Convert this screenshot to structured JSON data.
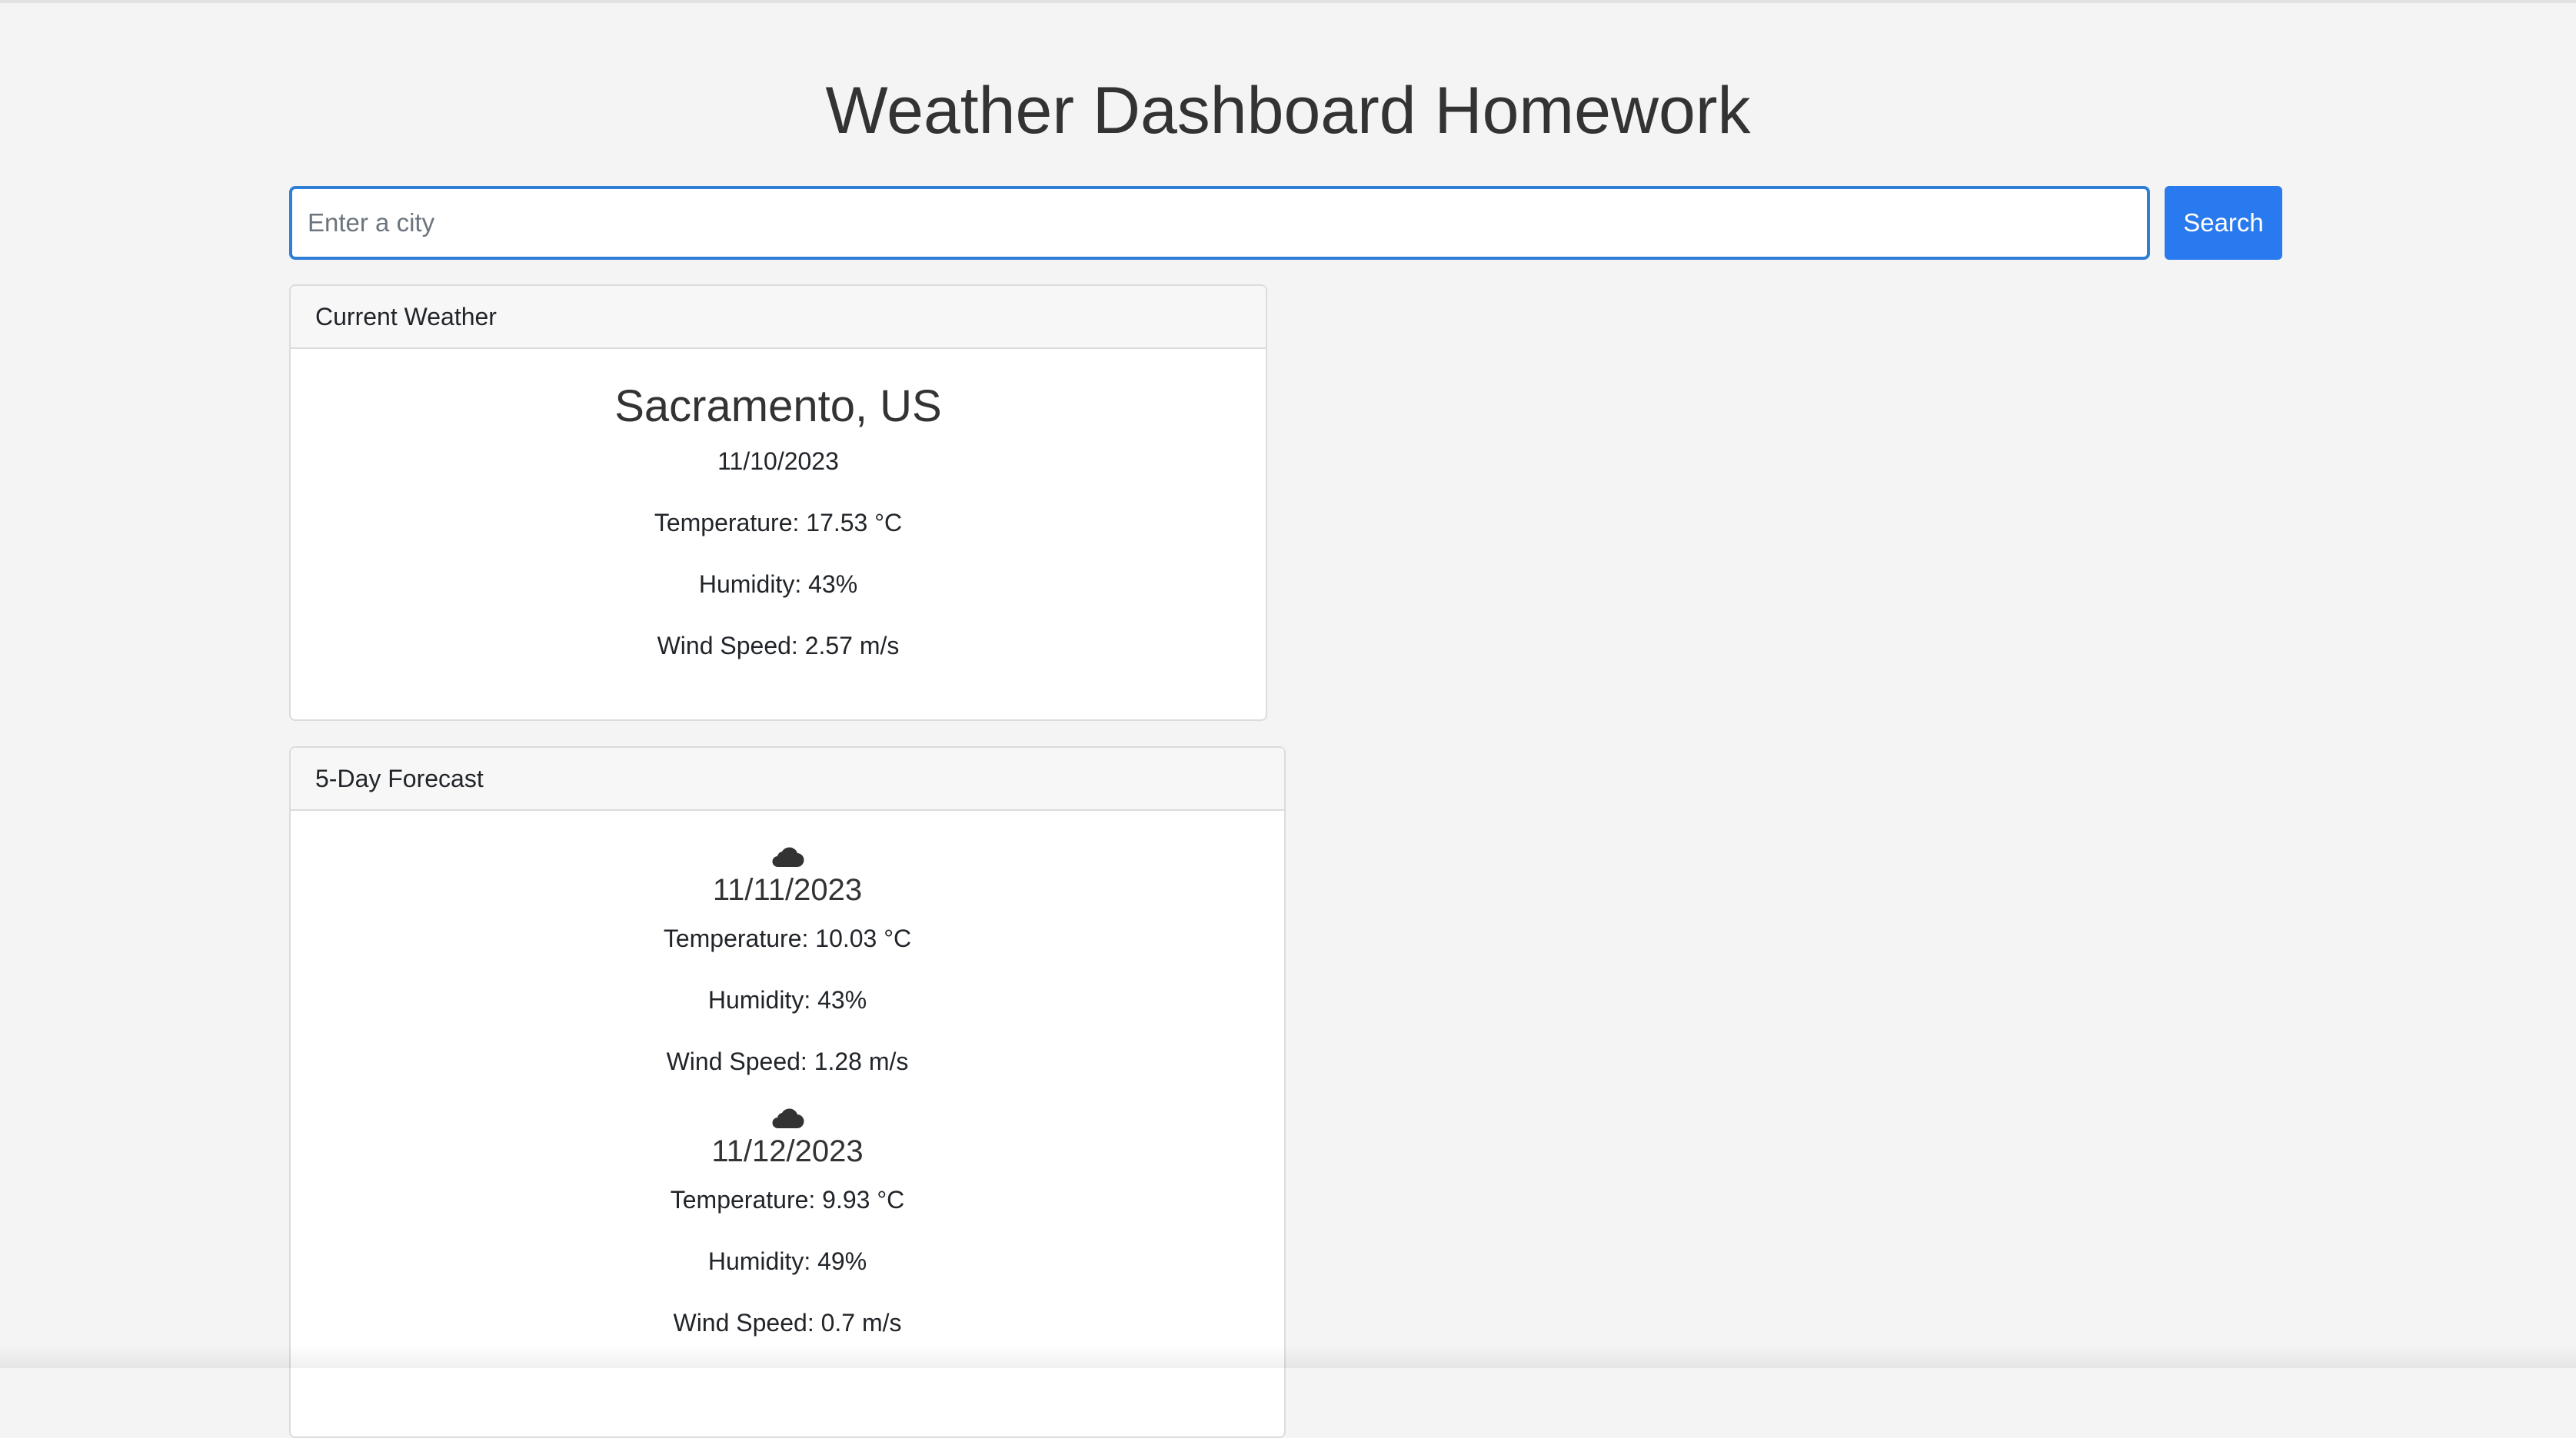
{
  "header": {
    "title": "Weather Dashboard Homework"
  },
  "search": {
    "placeholder": "Enter a city",
    "value": "",
    "button_label": "Search"
  },
  "current": {
    "header_label": "Current Weather",
    "city": "Sacramento, US",
    "date": "11/10/2023",
    "temperature": "Temperature: 17.53 °C",
    "humidity": "Humidity: 43%",
    "wind": "Wind Speed: 2.57 m/s"
  },
  "forecast": {
    "header_label": "5-Day Forecast",
    "days": [
      {
        "icon": "cloud-icon",
        "date": "11/11/2023",
        "temperature": "Temperature: 10.03 °C",
        "humidity": "Humidity: 43%",
        "wind": "Wind Speed: 1.28 m/s"
      },
      {
        "icon": "cloud-icon",
        "date": "11/12/2023",
        "temperature": "Temperature: 9.93 °C",
        "humidity": "Humidity: 49%",
        "wind": "Wind Speed: 0.7 m/s"
      }
    ]
  },
  "colors": {
    "background": "#f4f4f4",
    "accent": "#2a7aef",
    "input_border": "#2f7fd6"
  }
}
